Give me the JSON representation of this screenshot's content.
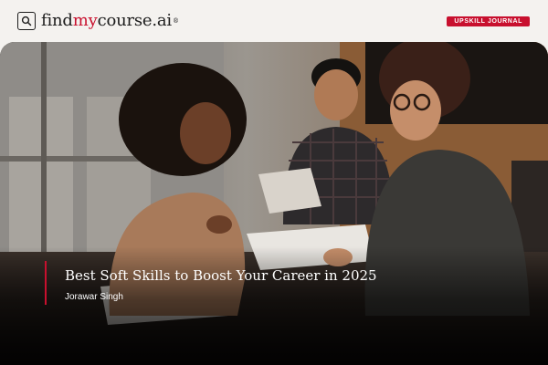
{
  "brand": {
    "name_part1": "find",
    "name_accent": "my",
    "name_part2": "course.ai",
    "trademark": "®",
    "accent_color": "#c8102e"
  },
  "badge": {
    "label": "UPSKILL JOURNAL"
  },
  "article": {
    "title": "Best Soft Skills to Boost Your Career in 2025",
    "author": "Jorawar Singh"
  },
  "hero_image": {
    "description": "three people smiling and reviewing papers at a table",
    "icon": "photo"
  }
}
